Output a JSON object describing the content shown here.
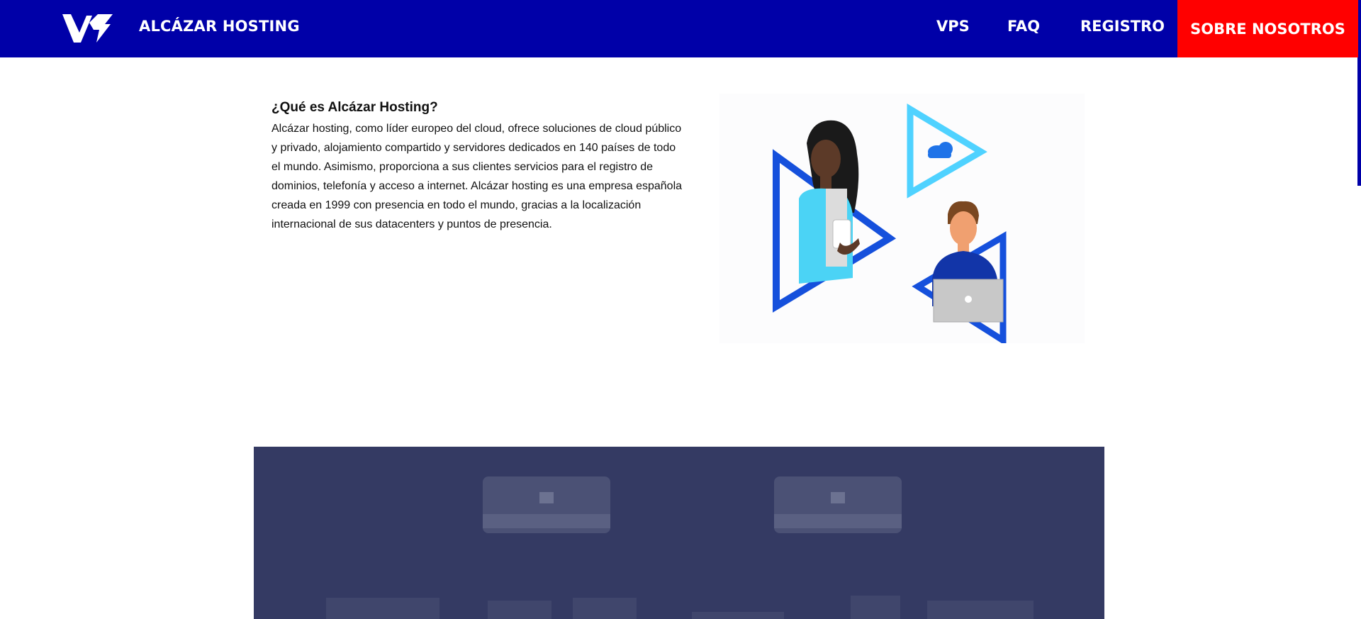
{
  "header": {
    "brand": "ALCÁZAR HOSTING",
    "nav": {
      "vps": "VPS",
      "faq": "FAQ",
      "registro": "REGISTRO",
      "sobre_nosotros": "SOBRE NOSOTROS"
    },
    "active_item": "SOBRE NOSOTROS",
    "colors": {
      "nav_bg": "#0000a8",
      "active_bg": "#ff0000",
      "text": "#ffffff"
    }
  },
  "about": {
    "title": "¿Qué es Alcázar Hosting?",
    "body": "Alcázar hosting, como líder europeo del cloud, ofrece soluciones de cloud público y privado, alojamiento compartido y servidores dedicados en 140 países de todo el mundo. Asimismo, proporciona a sus clientes servicios para el registro de dominios, telefonía y acceso a internet. Alcázar hosting es una empresa española creada en 1999 con presencia en todo el mundo, gracias a la localización internacional de sus datacenters y puntos de presencia."
  },
  "illustration": {
    "icon": "cloud-icon"
  },
  "servers_panel": {
    "color": "#343a63"
  }
}
